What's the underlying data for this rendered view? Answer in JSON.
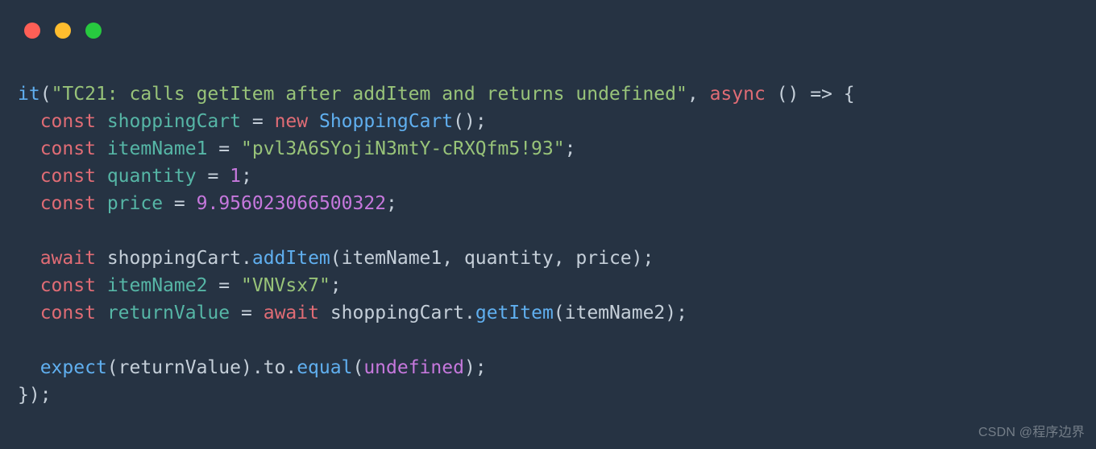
{
  "window": {
    "traffic_lights": [
      "close",
      "minimize",
      "zoom"
    ]
  },
  "code": {
    "line1": {
      "fn": "it",
      "str": "\"TC21: calls getItem after addItem and returns undefined\"",
      "async": "async",
      "arrow": "() => {"
    },
    "line2": {
      "kw": "const",
      "name": "shoppingCart",
      "eq": "=",
      "new": "new",
      "ctor": "ShoppingCart",
      "tail": "();"
    },
    "line3": {
      "kw": "const",
      "name": "itemName1",
      "eq": "=",
      "str": "\"pvl3A6SYojiN3mtY-cRXQfm5!93\"",
      "tail": ";"
    },
    "line4": {
      "kw": "const",
      "name": "quantity",
      "eq": "=",
      "num": "1",
      "tail": ";"
    },
    "line5": {
      "kw": "const",
      "name": "price",
      "eq": "=",
      "num": "9.956023066500322",
      "tail": ";"
    },
    "line7": {
      "kw": "await",
      "obj": "shoppingCart",
      "dot": ".",
      "method": "addItem",
      "args": "(itemName1, quantity, price);"
    },
    "line8": {
      "kw": "const",
      "name": "itemName2",
      "eq": "=",
      "str": "\"VNVsx7\"",
      "tail": ";"
    },
    "line9": {
      "kw1": "const",
      "name": "returnValue",
      "eq": "=",
      "kw2": "await",
      "obj": "shoppingCart",
      "dot": ".",
      "method": "getItem",
      "args": "(itemName2);"
    },
    "line11": {
      "fn": "expect",
      "arg1": "(returnValue)",
      "dot1": ".to.",
      "method": "equal",
      "open": "(",
      "undef": "undefined",
      "close": ");"
    },
    "line12": {
      "close": "});"
    }
  },
  "watermark": "CSDN @程序边界"
}
